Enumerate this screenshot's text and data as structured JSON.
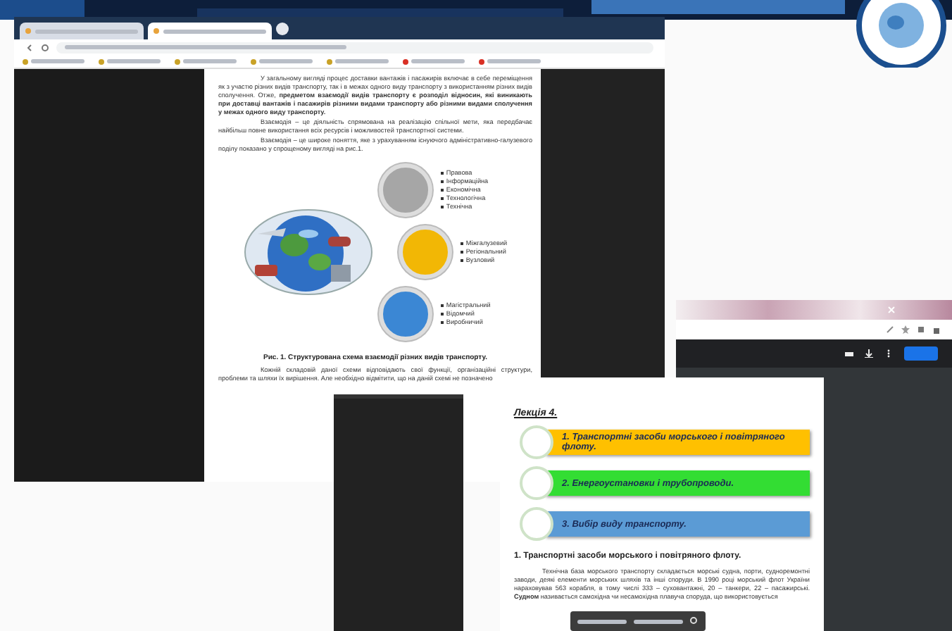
{
  "browser_a": {
    "tabs": [
      {
        "selected": false
      },
      {
        "selected": true
      }
    ]
  },
  "document": {
    "paragraphs": [
      "У загальному вигляді процес доставки вантажів і пасажирів включає в себе переміщення як з участю різних видів транспорту, так і в межах одного виду транспорту з використанням різних видів сполучення. Отже, **предметом взаємодії видів транспорту є розподіл відносин, які виникають при доставці вантажів і пасажирів різними видами транспорту або різними видами сполучення у межах одного виду транспорту.**",
      "Взаємодія – це діяльність спрямована на реалізацію спільної мети, яка передбачає найбільш повне використання всіх ресурсів і можливостей транспортної системи.",
      "Взаємодія – це широке поняття, яке з урахуванням існуючого адміністративно-галузевого поділу показано у спрощеному вигляді на рис.1."
    ],
    "diagram": [
      {
        "color": "#a6a6a6",
        "items": [
          "Правова",
          "Інформаційна",
          "Економічна",
          "Технологічна",
          "Технічна"
        ]
      },
      {
        "color": "#f2b705",
        "items": [
          "Міжгалузевий",
          "Регіональний",
          "Вузловий"
        ]
      },
      {
        "color": "#3b87d4",
        "items": [
          "Магістральний",
          "Відомчий",
          "Виробничий"
        ]
      }
    ],
    "caption": "Рис. 1. Структурована схема взаємодії різних видів транспорту.",
    "closing": "Кожній складовій даної схеми відповідають свої функції, організаційні структури, проблеми та шляхи їх вирішення. Але необхідно відмітити, що на даній схемі не позначено"
  },
  "pdf": {
    "title": "Лекція 4.",
    "topics": [
      {
        "label": "1. Транспортні засоби морського і повітряного флоту.",
        "color": "#ffc000"
      },
      {
        "label": "2. Енергоустановки і трубопроводи.",
        "color": "#33dd33"
      },
      {
        "label": "3. Вибір виду транспорту.",
        "color": "#5b9bd5"
      }
    ],
    "heading": "1. Транспортні засоби морського і повітряного флоту.",
    "body": "Технічна база морського транспорту складається морські судна, порти, судноремонтні заводи, деякі елементи морських шляхів та інші споруди. В 1990 році морський флот України нараховував 563 корабля, в тому числі 333 – суховантажні, 20 – танкери, 22 – пасажирські. **Судном** називається самохідна чи несамохідна плавуча споруда, що використовується"
  }
}
